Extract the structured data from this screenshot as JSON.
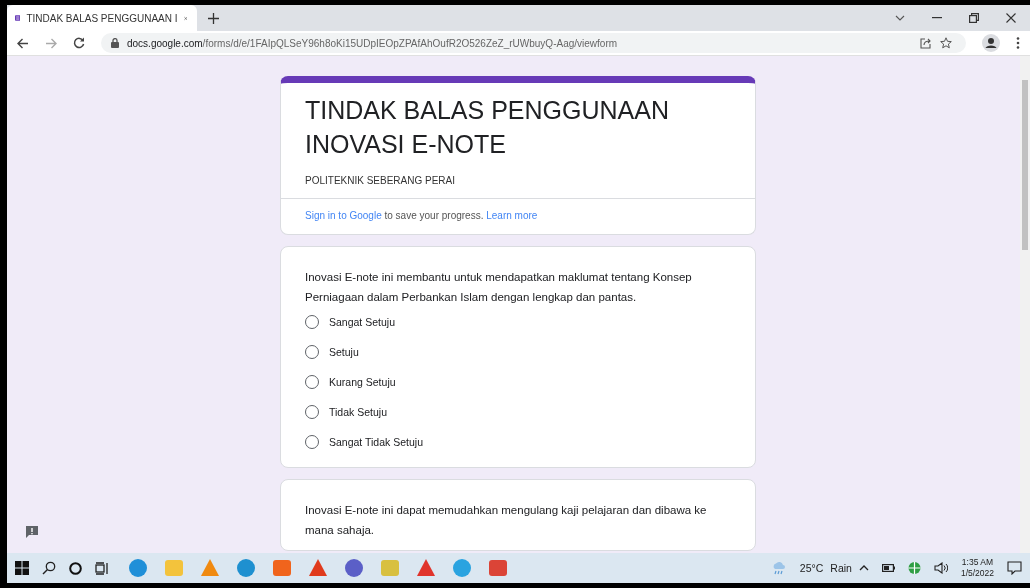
{
  "browser": {
    "tab_title": "TINDAK BALAS PENGGUNAAN I",
    "url_domain": "docs.google.com",
    "url_path": "/forms/d/e/1FAIpQLSeY96h8oKi15UDpIEOpZPAfAhOufR2O526ZeZ_rUWbuyQ-Aag/viewform"
  },
  "form": {
    "title": "TINDAK BALAS PENGGUNAAN INOVASI E-NOTE",
    "subtitle": "POLITEKNIK SEBERANG PERAI",
    "sign_in": {
      "link": "Sign in to Google",
      "text": " to save your progress. ",
      "learn_more": "Learn more"
    },
    "questions": [
      {
        "text": "Inovasi E-note ini membantu untuk mendapatkan maklumat tentang Konsep Perniagaan dalam Perbankan Islam dengan lengkap dan pantas.",
        "options": [
          {
            "label": "Sangat Setuju",
            "selected": false
          },
          {
            "label": "Setuju",
            "selected": false
          },
          {
            "label": "Kurang Setuju",
            "selected": false
          },
          {
            "label": "Tidak Setuju",
            "selected": false
          },
          {
            "label": "Sangat Tidak Setuju",
            "selected": false
          }
        ]
      },
      {
        "text": "Inovasi E-note ini dapat memudahkan mengulang kaji pelajaran dan dibawa ke mana sahaja."
      }
    ]
  },
  "taskbar": {
    "temperature": "25°C",
    "weather": "Rain",
    "time": "1:35 AM",
    "date": "1/5/2022"
  }
}
